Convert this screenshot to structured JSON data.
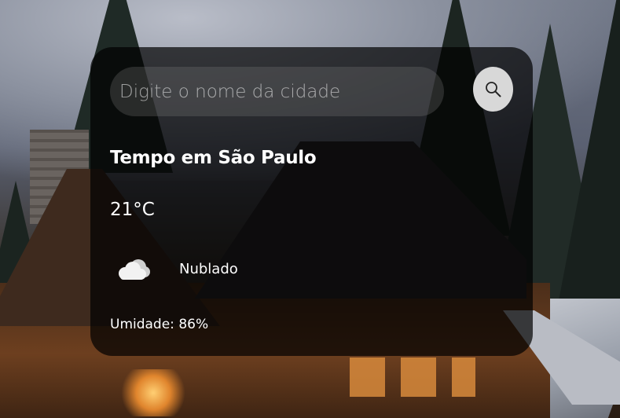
{
  "search": {
    "placeholder": "Digite o nome da cidade",
    "value": "",
    "button_icon": "search-icon"
  },
  "weather": {
    "title": "Tempo em São Paulo",
    "temperature": "21°C",
    "condition_icon": "cloud-icon",
    "condition": "Nublado",
    "humidity": "Umidade: 86%"
  },
  "colors": {
    "card_background": "#000000b3",
    "text": "#ffffff",
    "search_field": "#7c7c7c47",
    "search_button": "#d8d8d8"
  }
}
